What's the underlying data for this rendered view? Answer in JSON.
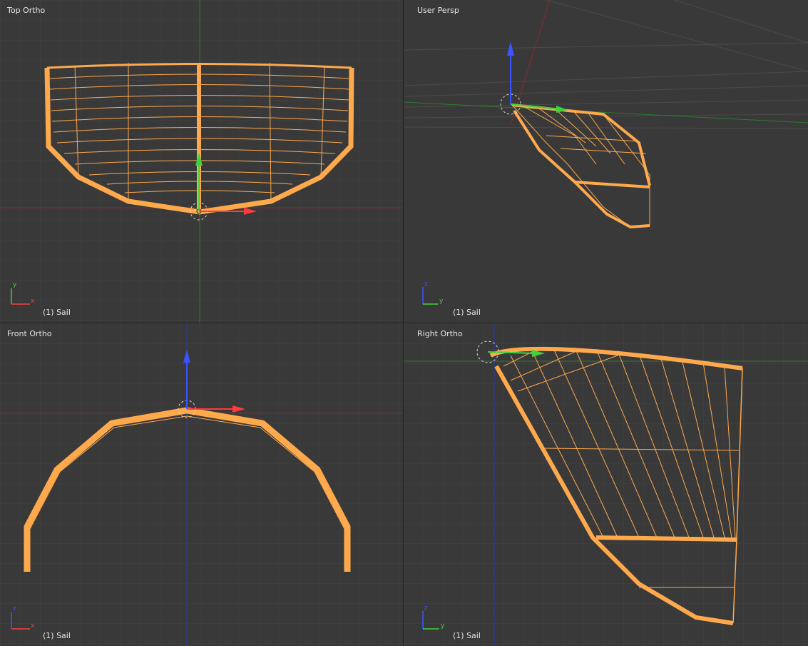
{
  "viewports": {
    "top_left": {
      "title": "Top Ortho",
      "object": "(1) Sail",
      "axes": [
        "y",
        "x"
      ]
    },
    "top_right": {
      "title": "User Persp",
      "object": "(1) Sail",
      "axes": [
        "z",
        "y"
      ]
    },
    "bottom_left": {
      "title": "Front Ortho",
      "object": "(1) Sail",
      "axes": [
        "z",
        "x"
      ]
    },
    "bottom_right": {
      "title": "Right Ortho",
      "object": "(1) Sail",
      "axes": [
        "z",
        "y"
      ]
    }
  },
  "colors": {
    "background": "#393939",
    "grid": "#424242",
    "selection": "#ffa94d",
    "x_axis": "#ff3b3b",
    "y_axis": "#3fd13f",
    "z_axis": "#3a55ff"
  }
}
